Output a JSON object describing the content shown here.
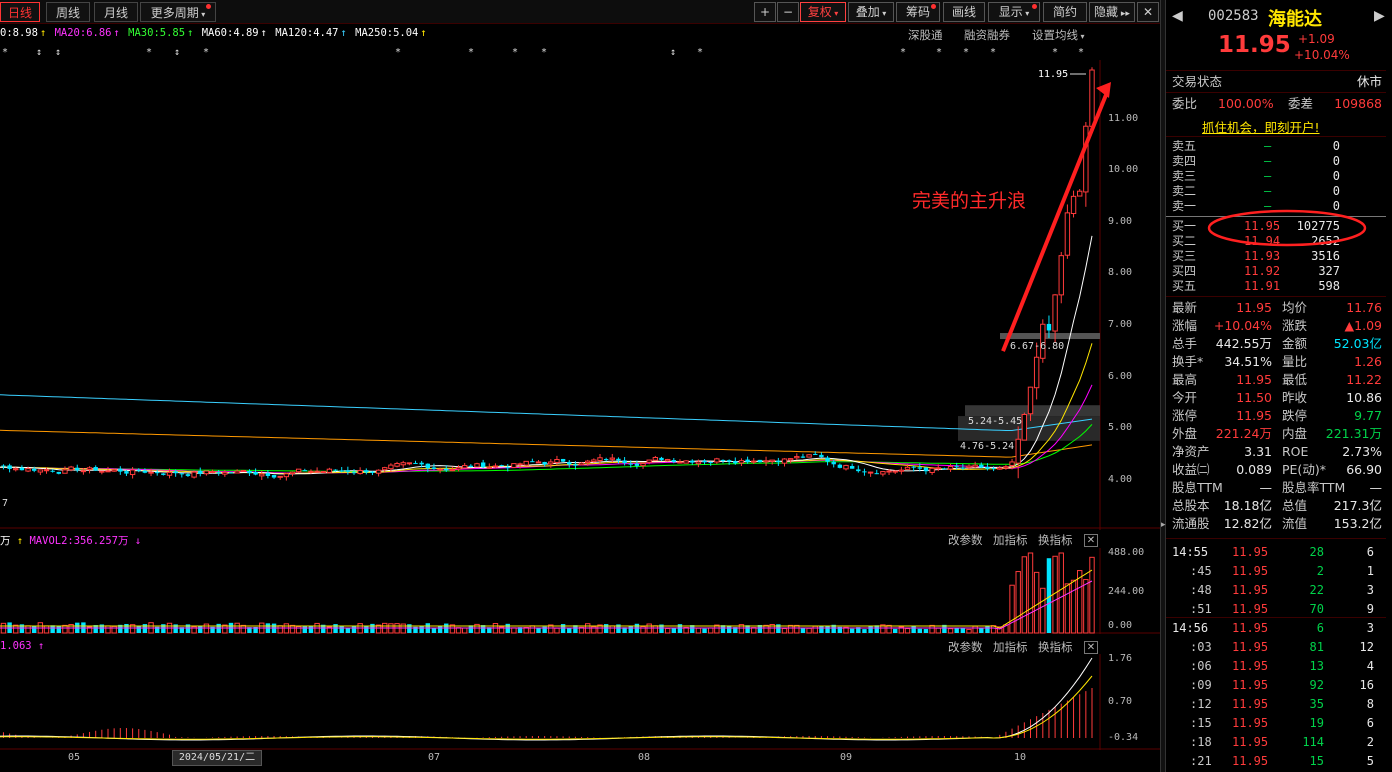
{
  "tabs": {
    "daily": "日线",
    "weekly": "周线",
    "monthly": "月线",
    "more": "更多周期"
  },
  "toolbar": {
    "plus": "+",
    "minus": "−",
    "fuquan": "复权",
    "overlay": "叠加",
    "chips": "筹码",
    "draw": "画线",
    "display": "显示",
    "simple": "简约",
    "hide": "隐藏"
  },
  "ma_line": {
    "ma10": "0:8.98",
    "ma20": "MA20:6.86",
    "ma30": "MA30:5.85",
    "ma60": "MA60:4.89",
    "ma120": "MA120:4.47",
    "ma250": "MA250:5.04"
  },
  "chart_tools": {
    "sgt": "深股通",
    "margin": "融资融券",
    "ma_setting": "设置均线"
  },
  "price_axis": [
    "11.00",
    "10.00",
    "9.00",
    "8.00",
    "7.00",
    "6.00",
    "5.00",
    "4.00"
  ],
  "annotations": {
    "high_label": "11.95",
    "main_rise": "完美的主升浪",
    "zone1": "6.67-6.80",
    "zone2": "5.24-5.45",
    "zone3": "4.76-5.24",
    "left_low": "7"
  },
  "volume_panel": {
    "unit": "万",
    "mavol2": "MAVOL2:356.257万",
    "axis": [
      "488.00",
      "244.00",
      "0.00"
    ],
    "btn_params": "改参数",
    "btn_add": "加指标",
    "btn_switch": "换指标"
  },
  "indicator_panel": {
    "value": "1.063",
    "axis": [
      "1.76",
      "0.70",
      "-0.34"
    ],
    "btn_params": "改参数",
    "btn_add": "加指标",
    "btn_switch": "换指标"
  },
  "x_axis": {
    "labels": [
      "05",
      "07",
      "08",
      "09",
      "10"
    ],
    "cursor_date": "2024/05/21/二"
  },
  "chart_data": {
    "type": "candlestick",
    "title": "",
    "y_range": [
      3.7,
      12.1
    ],
    "recent_closes": [
      4.35,
      4.79,
      5.27,
      5.8,
      6.38,
      7.02,
      6.9,
      7.59,
      8.35,
      9.18,
      9.5,
      9.6,
      10.86,
      11.95
    ],
    "last_price": 11.95,
    "colors": {
      "up": "#ff3b3b",
      "down": "#00e5ff",
      "ma10": "#ffffff",
      "ma20": "#ffe600",
      "ma30": "#ff00ff",
      "ma60": "#00ff00",
      "ma120": "#ff9900",
      "ma250": "#3ad0ff"
    }
  },
  "quote": {
    "code": "002583",
    "name": "海能达",
    "price": "11.95",
    "change": "+1.09",
    "change_pct": "+10.04%",
    "trade_state_label": "交易状态",
    "trade_state": "休市",
    "weibi_label": "委比",
    "weibi": "100.00%",
    "weicha_label": "委差",
    "weicha": "109868",
    "promo": "抓住机会，即刻开户!",
    "asks": [
      {
        "label": "卖五",
        "price": "—",
        "vol": "0"
      },
      {
        "label": "卖四",
        "price": "—",
        "vol": "0"
      },
      {
        "label": "卖三",
        "price": "—",
        "vol": "0"
      },
      {
        "label": "卖二",
        "price": "—",
        "vol": "0"
      },
      {
        "label": "卖一",
        "price": "—",
        "vol": "0"
      }
    ],
    "bids": [
      {
        "label": "买一",
        "price": "11.95",
        "vol": "102775"
      },
      {
        "label": "买二",
        "price": "11.94",
        "vol": "2652"
      },
      {
        "label": "买三",
        "price": "11.93",
        "vol": "3516"
      },
      {
        "label": "买四",
        "price": "11.92",
        "vol": "327"
      },
      {
        "label": "买五",
        "price": "11.91",
        "vol": "598"
      }
    ],
    "stats": [
      {
        "l1": "最新",
        "v1": "11.95",
        "c1": "red",
        "l2": "均价",
        "v2": "11.76",
        "c2": "red"
      },
      {
        "l1": "涨幅",
        "v1": "+10.04%",
        "c1": "red",
        "l2": "涨跌",
        "v2": "▲1.09",
        "c2": "red"
      },
      {
        "l1": "总手",
        "v1": "442.55万",
        "c1": "white",
        "l2": "金额",
        "v2": "52.03亿",
        "c2": "cyan"
      },
      {
        "l1": "换手*",
        "v1": "34.51%",
        "c1": "white",
        "l2": "量比",
        "v2": "1.26",
        "c2": "red"
      },
      {
        "l1": "最高",
        "v1": "11.95",
        "c1": "red",
        "l2": "最低",
        "v2": "11.22",
        "c2": "red"
      },
      {
        "l1": "今开",
        "v1": "11.50",
        "c1": "red",
        "l2": "昨收",
        "v2": "10.86",
        "c2": "white"
      },
      {
        "l1": "涨停",
        "v1": "11.95",
        "c1": "red",
        "l2": "跌停",
        "v2": "9.77",
        "c2": "green"
      },
      {
        "l1": "外盘",
        "v1": "221.24万",
        "c1": "red",
        "l2": "内盘",
        "v2": "221.31万",
        "c2": "green"
      },
      {
        "l1": "净资产",
        "v1": "3.31",
        "c1": "white",
        "l2": "ROE",
        "v2": "2.73%",
        "c2": "white"
      },
      {
        "l1": "收益㈡",
        "v1": "0.089",
        "c1": "white",
        "l2": "PE(动)*",
        "v2": "66.90",
        "c2": "white"
      },
      {
        "l1": "股息TTM",
        "v1": "—",
        "c1": "white",
        "l2": "股息率TTM",
        "v2": "—",
        "c2": "white"
      },
      {
        "l1": "总股本",
        "v1": "18.18亿",
        "c1": "white",
        "l2": "总值",
        "v2": "217.3亿",
        "c2": "white"
      },
      {
        "l1": "流通股",
        "v1": "12.82亿",
        "c1": "white",
        "l2": "流值",
        "v2": "153.2亿",
        "c2": "white"
      }
    ],
    "ticks": [
      {
        "time": "14:55",
        "price": "11.95",
        "vol": "28",
        "n": "6"
      },
      {
        "time": ":45",
        "price": "11.95",
        "vol": "2",
        "n": "1"
      },
      {
        "time": ":48",
        "price": "11.95",
        "vol": "22",
        "n": "3"
      },
      {
        "time": ":51",
        "price": "11.95",
        "vol": "70",
        "n": "9"
      },
      {
        "time": "14:56",
        "price": "11.95",
        "vol": "6",
        "n": "3"
      },
      {
        "time": ":03",
        "price": "11.95",
        "vol": "81",
        "n": "12"
      },
      {
        "time": ":06",
        "price": "11.95",
        "vol": "13",
        "n": "4"
      },
      {
        "time": ":09",
        "price": "11.95",
        "vol": "92",
        "n": "16"
      },
      {
        "time": ":12",
        "price": "11.95",
        "vol": "35",
        "n": "8"
      },
      {
        "time": ":15",
        "price": "11.95",
        "vol": "19",
        "n": "6"
      },
      {
        "time": ":18",
        "price": "11.95",
        "vol": "114",
        "n": "2"
      },
      {
        "time": ":21",
        "price": "11.95",
        "vol": "15",
        "n": "5"
      }
    ]
  }
}
